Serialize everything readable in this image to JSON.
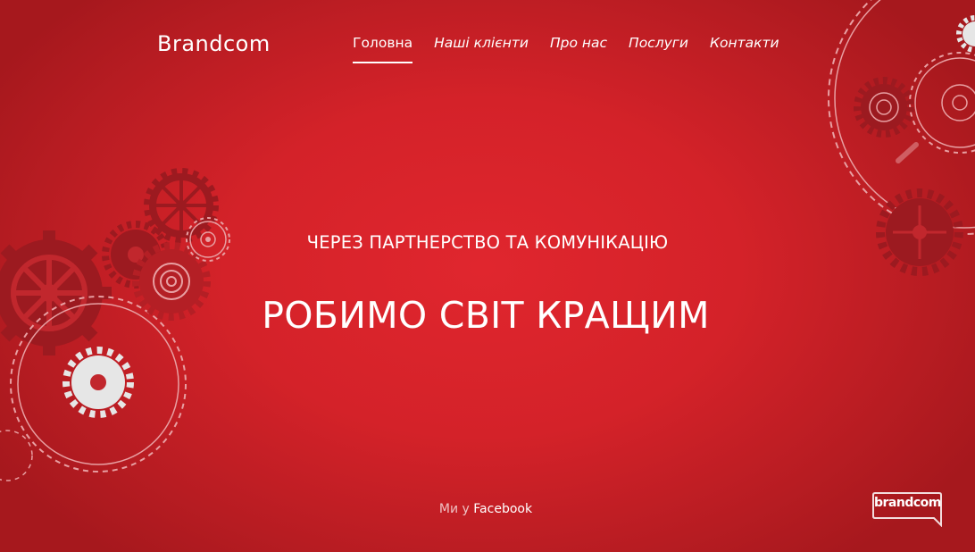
{
  "header": {
    "brand": "Brandcom",
    "nav": [
      {
        "label": "Головна",
        "active": true
      },
      {
        "label": "Наші клієнти",
        "active": false
      },
      {
        "label": "Про нас",
        "active": false
      },
      {
        "label": "Послуги",
        "active": false
      },
      {
        "label": "Контакти",
        "active": false
      }
    ]
  },
  "hero": {
    "subtitle": "ЧЕРЕЗ ПАРТНЕРСТВО ТА КОМУНІКАЦІЮ",
    "headline": "РОБИМО СВІТ КРАЩИМ"
  },
  "footer": {
    "facebook_prefix": "Ми у",
    "facebook_link": "Facebook"
  },
  "corner_logo": {
    "text": "brandcom"
  },
  "colors": {
    "background": "#d42229",
    "gear_dark": "#9c1a20",
    "gear_light": "#e6e6e6",
    "text": "#ffffff"
  },
  "icons": [
    "gear-icon",
    "brandcom-logo-icon"
  ]
}
